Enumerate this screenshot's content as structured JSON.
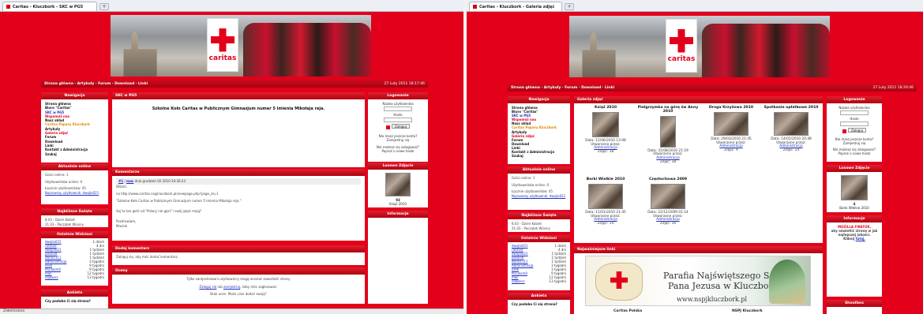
{
  "left_window": {
    "tab_title": "Caritas - Kluczbork - SKC w PG5",
    "navbar": {
      "links": "Strona główna · Artykuły · Forum · Download · Linki",
      "date": "27 Luty 2011 18:17:46"
    },
    "nav_header": "Nawigacja",
    "menu": [
      "Strona główna",
      "Biuro \"Caritas\"",
      "SKC w PG5",
      "Wspomóż nas",
      "Nasz skład",
      "Caritas Paparu Kluczbork",
      "Artykuły",
      "Galeria zdjęć",
      "Forum",
      "Download",
      "Linki",
      "Kontakt z Administracja",
      "Szukaj"
    ],
    "online_header": "Aktualnie online",
    "online_lines": [
      "Gości online: 1",
      "Użytkowników online: 0",
      "Łącznie użytkowników: 45",
      "Najnowszy użytkownik: dwojlo021"
    ],
    "holidays_header": "Najbliższe Święta",
    "holidays": [
      "8.03 - Dzień Kobiet",
      "21.03 - Początek Wiosny"
    ],
    "visited_header": "Ostatnio Widziani",
    "visited": [
      [
        "dwojlo021",
        "1 dzień"
      ],
      [
        "ratmed",
        "4 dni"
      ],
      [
        "dwojlo021",
        "1 tydzień"
      ],
      [
        "joeizio0",
        "1 tydzień"
      ],
      [
        "dariu1111",
        "1 tydzień"
      ],
      [
        "Administracja",
        "3 tygodni"
      ],
      [
        "kask",
        "9 tygodni"
      ],
      [
        "fe23asm0",
        "9 tygodni"
      ],
      [
        "mac",
        "12 tygodni"
      ],
      [
        "sdjkaers",
        "13 tygodni"
      ]
    ],
    "poll_header": "Ankieta",
    "poll_question": "Czy podoba Ci się strona?",
    "article_header": "SKC w PG5",
    "article_title": "Szkolne Koło Caritas w Publicznym Gimnazjum numer 5 imienia Mikołaja reja.",
    "comments_header": "Komentarze",
    "comment_meta_num": "#1",
    "comment_meta_user": "mac",
    "comment_meta_date": "dnia grudzień 02 2010 20:30:23",
    "comment_lines": [
      "Witam.",
      "na http://www.caritas.nspjkluczbork.pl/viewpage.php?page_id=1",
      "\"Szkolne Koło Caritas w Publicznym Gimnazjum numer 5 imienia Mikołaja reja.\"",
      "Saj to tan gość od \"Polacy nie gęsi\" i swój język mają?",
      "Pozdrawiam,",
      "Maciek"
    ],
    "add_comment_header": "Dodaj komentarz",
    "add_comment_text": "Zaloguj się, aby móc dodać komentarz.",
    "ratings_header": "Oceny",
    "ratings_line1": "Tylko zarejestrowani użytkownicy mogą oceniać zawartość strony",
    "ratings_link1": "Zaloguj się",
    "ratings_mid": "lub",
    "ratings_link2": "zarejestruj",
    "ratings_tail": ", żeby móc zagłosować.",
    "ratings_line3": "Brak ocen. Może czas dodać swoją?",
    "login_header": "Logowanie",
    "login_user": "Nazwa użytkownika",
    "login_pass": "Hasło",
    "login_button": "Zaloguj",
    "login_q1": "Nie masz jeszcze konta?",
    "login_a1": "Zarejestruj się",
    "login_q2": "Nie możesz się zalogować?",
    "login_a2": "Poproś o nowe hasło",
    "random_header": "Losowe Zdjęcie",
    "random_num": "93",
    "random_caption": "Książ 2010",
    "info_header": "Informacje",
    "status": "Zakończono"
  },
  "right_window": {
    "tab_title": "Caritas - Kluczbork - Galeria zdjęć",
    "navbar": {
      "links": "Strona główna · Artykuły · Forum · Download · Linki",
      "date": "27 Luty 2011 18:20:46"
    },
    "nav_header": "Nawigacja",
    "menu": [
      "Strona główna",
      "Biuro \"Caritas\"",
      "SKC w PG5",
      "Wspomóż nas",
      "Nasz skład",
      "Caritas Paparu Kluczbork",
      "Artykuły",
      "Galeria zdjęć",
      "Forum",
      "Download",
      "Linki",
      "Kontakt z Administracja",
      "Szukaj"
    ],
    "online_header": "Aktualnie online",
    "online_lines": [
      "Gości online: 1",
      "Użytkowników online: 0",
      "Łącznie użytkowników: 45",
      "Najnowszy użytkownik: dwojlo021"
    ],
    "holidays_header": "Najbliższe Święta",
    "holidays": [
      "8.03 - Dzień Kobiet",
      "21.03 - Początek Wiosny"
    ],
    "visited_header": "Ostatnio Widziani",
    "visited": [
      [
        "dwojlo021",
        "1 dzień"
      ],
      [
        "ratmed",
        "4 dni"
      ],
      [
        "dwojlo021",
        "1 tydzień"
      ],
      [
        "joeizio0",
        "1 tydzień"
      ],
      [
        "dariu1111",
        "1 tydzień"
      ],
      [
        "Administracja",
        "3 tygodni"
      ],
      [
        "lizek",
        "3 tygodni"
      ],
      [
        "fe23asm0",
        "9 tygodni"
      ],
      [
        "mac",
        "12 tygodni"
      ],
      [
        "sdjkaers",
        "13 tygodni"
      ]
    ],
    "poll_header": "Ankieta",
    "poll_question": "Czy podoba Ci się strona?",
    "gallery_header": "Galeria zdjęć",
    "gallery": [
      {
        "title": "Książ 2010",
        "date": "Data: 12/06/2010 13:08",
        "by": "Utworzone przez:",
        "author": "Administracja",
        "count": "Zdjęć: 18"
      },
      {
        "title": "Pielgrzymka na górę św Anny 2010",
        "date": "Data: 31/08/2010 21:19",
        "by": "Utworzone przez:",
        "author": "Administracja",
        "count": "Zdjęć: 18"
      },
      {
        "title": "Droga Krzyżowa 2010",
        "date": "Data: 29/03/2010 21:45",
        "by": "Utworzone przez:",
        "author": "Administracja",
        "count": "Zdjęć: 9"
      },
      {
        "title": "Spotkanie opłatkowe 2010",
        "date": "Data: 14/01/2010 20:48",
        "by": "Utworzone przez:",
        "author": "Administracja",
        "count": "Zdjęć: 14"
      },
      {
        "title": "Borki Wielkie 2010",
        "date": "Data: 11/01/2010 21:45",
        "by": "Utworzone przez:",
        "author": "Administracja",
        "count": "Zdjęć: 14"
      },
      {
        "title": "Częstochowa 2009",
        "date": "Data: 22/12/2009 01:14",
        "by": "Utworzone przez:",
        "author": "Administracja",
        "count": "Zdjęć: 16"
      }
    ],
    "links_header": "Najważniejsze linki",
    "ad_line1": "Parafia Najświętszego Serca",
    "ad_line2": "Pana Jezusa w Kluczborku",
    "ad_line3": "www.nspjkluczbork.pl",
    "links_bottom": [
      "Caritas Polska",
      "NSPJ Kluczbork"
    ],
    "login_header": "Logowanie",
    "login_user": "Nazwa użytkownika",
    "login_pass": "Hasło",
    "login_button": "Zaloguj",
    "login_q1": "Nie masz jeszcze konta?",
    "login_a1": "Zarejestruj się",
    "login_q2": "Nie możesz się zalogować?",
    "login_a2": "Poproś o nowe hasło",
    "random_header": "Losowe Zdjęcie",
    "random_num": "4",
    "random_caption": "Borki Wielkie 2010",
    "info_header": "Informacje",
    "info_text1": "MOZILLA FIREFOX,",
    "info_text2": "aby oświetlić stronę w jak",
    "info_text3": "najlepszej jakości.",
    "info_text4": "Kliknij",
    "info_link": "tutaj.",
    "shoutbox_header": "Shoutbox"
  }
}
